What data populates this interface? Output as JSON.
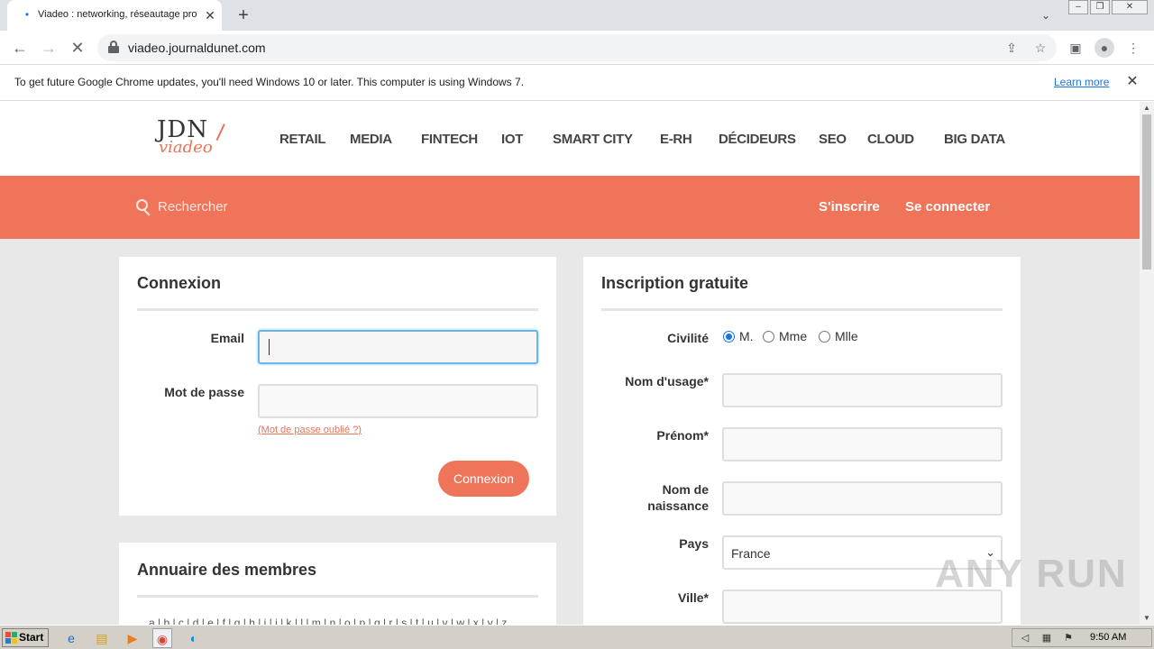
{
  "browser": {
    "tab_title": "Viadeo : networking, réseautage pro",
    "url": "viadeo.journaldunet.com"
  },
  "infobar": {
    "message": "To get future Google Chrome updates, you'll need Windows 10 or later. This computer is using Windows 7.",
    "learn_more": "Learn more"
  },
  "site": {
    "logo_top": "JDN",
    "logo_bottom": "viadeo",
    "nav": [
      "RETAIL",
      "MEDIA",
      "FINTECH",
      "IOT",
      "SMART CITY",
      "E-RH",
      "DÉCIDEURS",
      "SEO",
      "CLOUD",
      "BIG DATA"
    ],
    "search_placeholder": "Rechercher",
    "signup_link": "S'inscrire",
    "login_link": "Se connecter"
  },
  "login": {
    "title": "Connexion",
    "email_label": "Email",
    "email_value": "",
    "password_label": "Mot de passe",
    "forgot_link": "(Mot de passe oublié ?)",
    "submit_label": "Connexion"
  },
  "directory": {
    "title": "Annuaire des membres",
    "letters": "a | b | c | d | e | f | g | h | i | j | k | l | m | n | o | p | q | r | s | t | u | v | w | x | y | z"
  },
  "signup": {
    "title": "Inscription gratuite",
    "civility_label": "Civilité",
    "civility_options": [
      "M.",
      "Mme",
      "Mlle"
    ],
    "civility_selected": "M.",
    "usage_name_label": "Nom d'usage*",
    "first_name_label": "Prénom*",
    "birth_name_label_1": "Nom de",
    "birth_name_label_2": "naissance",
    "country_label": "Pays",
    "country_value": "France",
    "city_label": "Ville*"
  },
  "watermark": "ANY RUN",
  "taskbar": {
    "start_label": "Start",
    "clock": "9:50 AM"
  },
  "colors": {
    "accent": "#ef7459",
    "focus": "#6ab6e8",
    "link_blue": "#1a73e8"
  }
}
